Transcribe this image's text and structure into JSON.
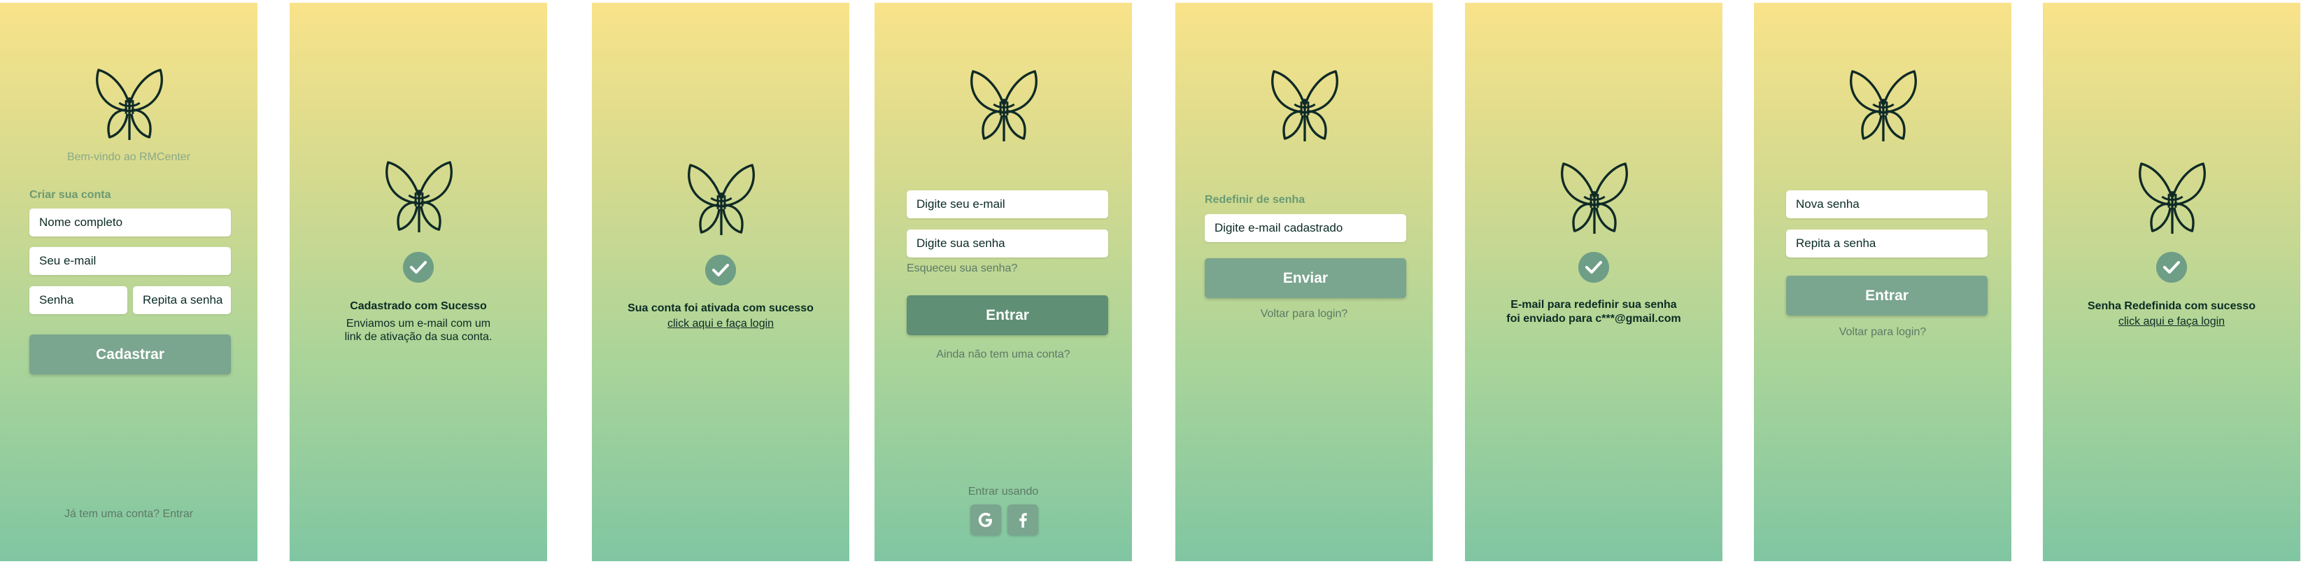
{
  "signup": {
    "welcome": "Bem-vindo ao RMCenter",
    "section_title": "Criar sua conta",
    "name_placeholder": "Nome completo",
    "email_placeholder": "Seu e-mail",
    "password_placeholder": "Senha",
    "repeat_password_placeholder": "Repita a senha",
    "submit_label": "Cadastrar",
    "login_prompt": "Já tem uma conta? Entrar"
  },
  "signup_success": {
    "title": "Cadastrado com Sucesso",
    "body_line1": "Enviamos um e-mail com um",
    "body_line2": "link de ativação da sua conta."
  },
  "activation_success": {
    "title": "Sua conta foi ativada com sucesso",
    "link": "click aqui e faça login"
  },
  "login": {
    "email_placeholder": "Digite seu e-mail",
    "password_placeholder": "Digite sua senha",
    "forgot_link": "Esqueceu sua senha?",
    "submit_label": "Entrar",
    "signup_prompt": "Ainda não tem uma conta?",
    "social_label": "Entrar usando",
    "social_icons": [
      "google-icon",
      "facebook-icon"
    ]
  },
  "reset_request": {
    "section_title": "Redefinir de senha",
    "email_placeholder": "Digite e-mail cadastrado",
    "submit_label": "Enviar",
    "back_link": "Voltar para login?"
  },
  "reset_email_sent": {
    "title_line1": "E-mail para redefinir sua senha",
    "title_line2": "foi enviado para c***@gmail.com"
  },
  "new_password": {
    "password_placeholder": "Nova senha",
    "repeat_placeholder": "Repita a senha",
    "submit_label": "Entrar",
    "back_link": "Voltar para login?"
  },
  "reset_success": {
    "title": "Senha Redefinida com sucesso",
    "link": "click aqui e faça login"
  },
  "colors": {
    "gradient_top": "#f9e38a",
    "gradient_bottom": "#80c6a2",
    "button": "#7aa58f",
    "button_dark": "#5f8f75",
    "check_badge": "#6f9e86",
    "text": "#0b2b24"
  }
}
